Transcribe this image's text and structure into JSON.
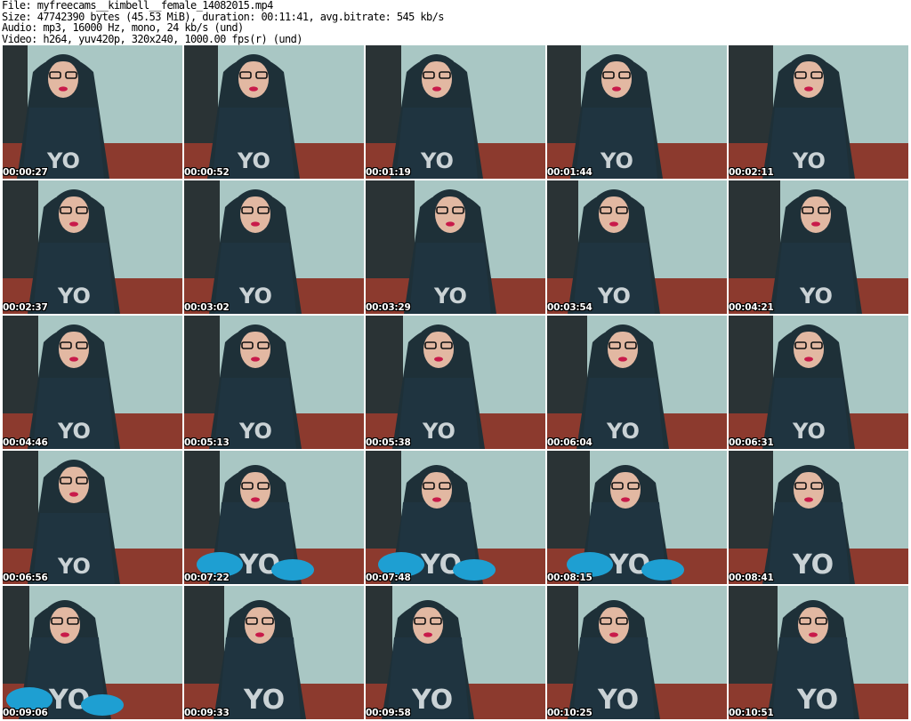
{
  "header": {
    "file": "File: myfreecams__kimbell__female_14082015.mp4",
    "size": "Size: 47742390 bytes (45.53 MiB), duration: 00:11:41, avg.bitrate: 545 kb/s",
    "audio": "Audio: mp3, 16000 Hz, mono, 24 kb/s (und)",
    "video": "Video: h264, yuv420p, 320x240, 1000.00 fps(r) (und)"
  },
  "thumbnails": [
    {
      "time": "00:00:27"
    },
    {
      "time": "00:00:52"
    },
    {
      "time": "00:01:19"
    },
    {
      "time": "00:01:44"
    },
    {
      "time": "00:02:11"
    },
    {
      "time": "00:02:37"
    },
    {
      "time": "00:03:02"
    },
    {
      "time": "00:03:29"
    },
    {
      "time": "00:03:54"
    },
    {
      "time": "00:04:21"
    },
    {
      "time": "00:04:46"
    },
    {
      "time": "00:05:13"
    },
    {
      "time": "00:05:38"
    },
    {
      "time": "00:06:04"
    },
    {
      "time": "00:06:31"
    },
    {
      "time": "00:06:56"
    },
    {
      "time": "00:07:22"
    },
    {
      "time": "00:07:48"
    },
    {
      "time": "00:08:15"
    },
    {
      "time": "00:08:41"
    },
    {
      "time": "00:09:06"
    },
    {
      "time": "00:09:33"
    },
    {
      "time": "00:09:58"
    },
    {
      "time": "00:10:25"
    },
    {
      "time": "00:10:51"
    }
  ],
  "colors": {
    "wall": "#a9c7c4",
    "curtain": "#1c2226",
    "hair": "#1e3038",
    "skin": "#e2b8a2",
    "shirt": "#1f3440",
    "lips": "#c81a4a",
    "bed": "#8c3a2e",
    "stockings": "#1e9fd2"
  }
}
